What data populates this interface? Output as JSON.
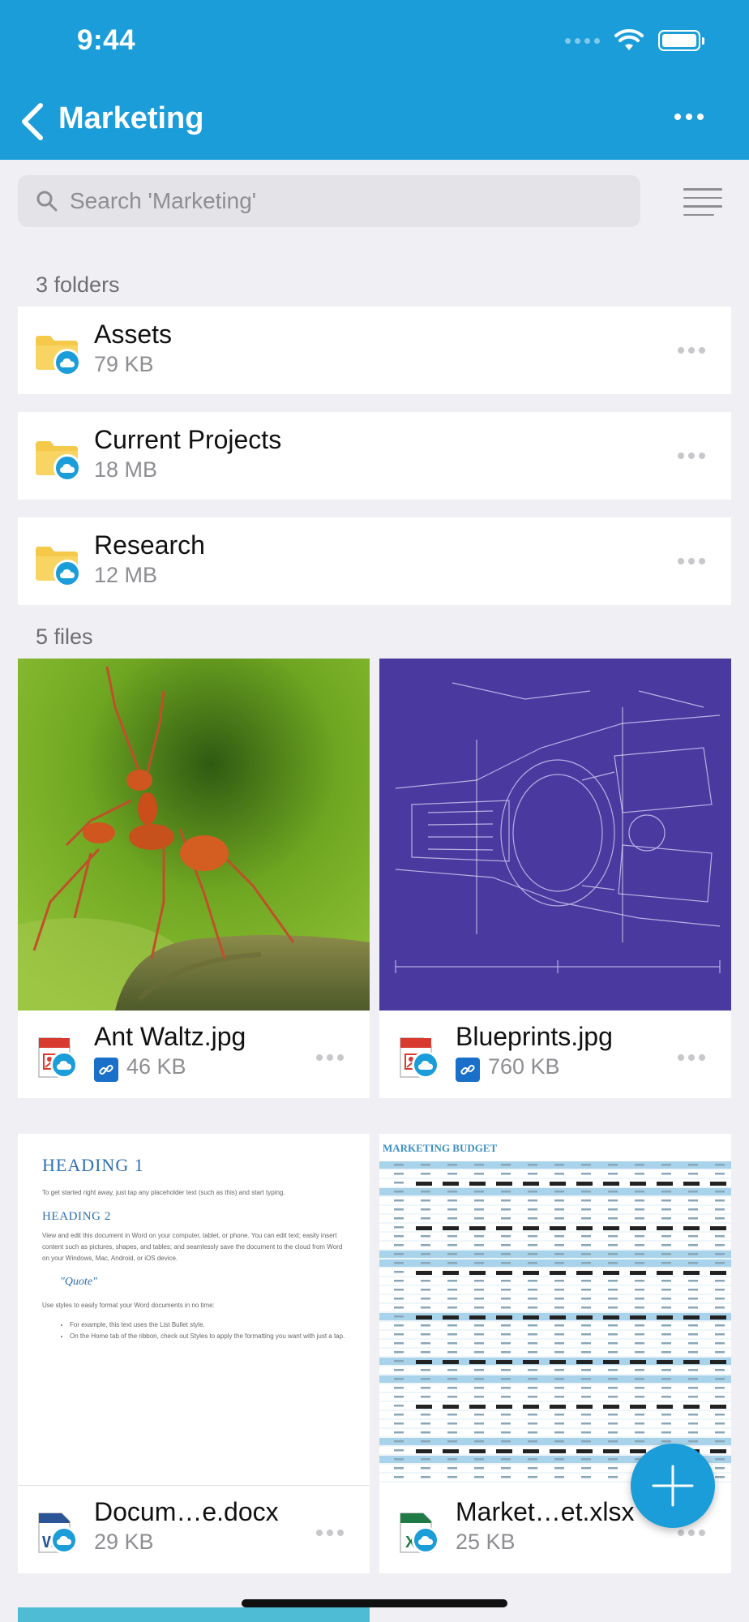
{
  "status_bar": {
    "time": "9:44"
  },
  "nav": {
    "title": "Marketing"
  },
  "search": {
    "placeholder": "Search 'Marketing'"
  },
  "folders_section": {
    "label": "3 folders",
    "items": [
      {
        "name": "Assets",
        "size": "79 KB"
      },
      {
        "name": "Current Projects",
        "size": "18 MB"
      },
      {
        "name": "Research",
        "size": "12 MB"
      }
    ]
  },
  "files_section": {
    "label": "5 files",
    "items": [
      {
        "name": "Ant Waltz.jpg",
        "size": "46 KB",
        "shared": true,
        "type_icon": "image-file-icon"
      },
      {
        "name": "Blueprints.jpg",
        "size": "760 KB",
        "shared": true,
        "type_icon": "image-file-icon"
      },
      {
        "name": "Docum…e.docx",
        "size": "29 KB",
        "shared": false,
        "type_icon": "word-file-icon"
      },
      {
        "name": "Market…et.xlsx",
        "size": "25 KB",
        "shared": false,
        "type_icon": "excel-file-icon"
      }
    ]
  },
  "doc_preview": {
    "heading1": "HEADING 1",
    "para1": "To get started right away, just tap any placeholder text (such as this) and start typing.",
    "heading2": "HEADING 2",
    "para2": "View and edit this document in Word on your computer, tablet, or phone. You can edit text; easily insert content such as pictures, shapes, and tables; and seamlessly save the document to the cloud from Word on your Windows, Mac, Android, or iOS device.",
    "quote": "\"Quote\"",
    "para3": "Use styles to easily format your Word documents in no time:",
    "bullet1": "For example, this text uses the List Bullet style.",
    "bullet2": "On the Home tab of the ribbon, check out Styles to apply the formatting you want with just a tap."
  },
  "sheet_preview": {
    "title": "MARKETING BUDGET"
  },
  "colors": {
    "accent": "#1a9dd9",
    "folder": "#f5c94a",
    "background": "#efeff4"
  }
}
